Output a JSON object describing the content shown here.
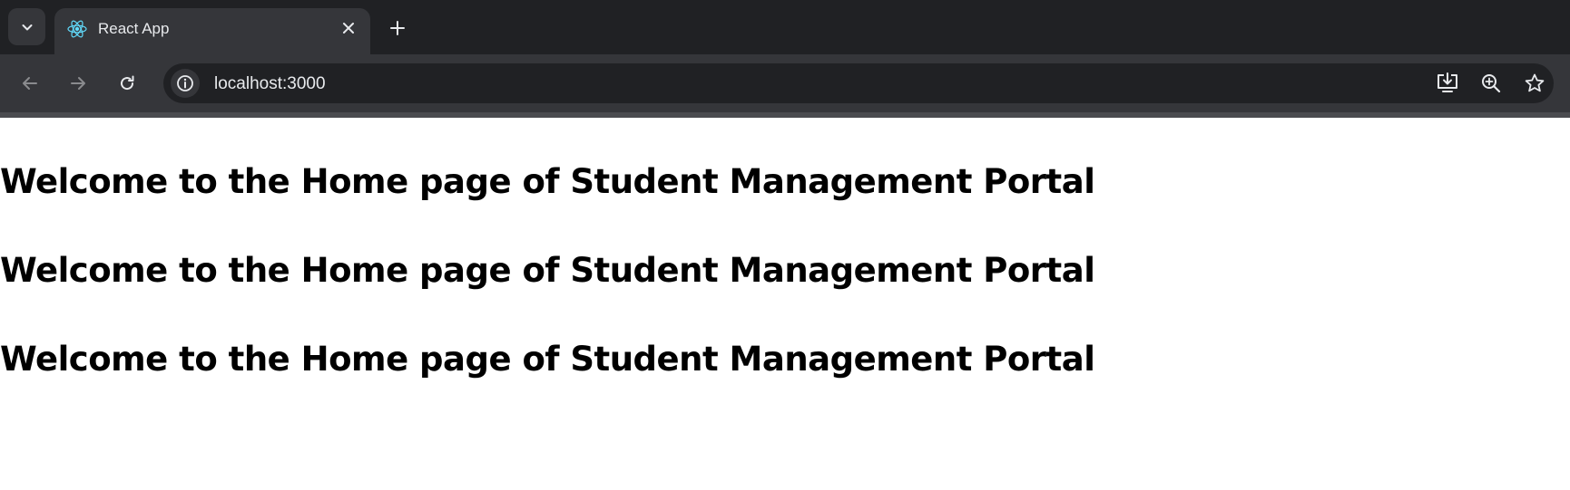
{
  "browser": {
    "tab": {
      "title": "React App",
      "favicon": "react-logo-icon"
    },
    "address_bar": {
      "url": "localhost:3000"
    },
    "colors": {
      "tabbar_bg": "#202124",
      "toolbar_bg": "#35363a",
      "omnibox_bg": "#202124",
      "text": "#e8eaed",
      "react_accent": "#61dafb"
    }
  },
  "page": {
    "headings": [
      "Welcome to the Home page of Student Management Portal",
      "Welcome to the Home page of Student Management Portal",
      "Welcome to the Home page of Student Management Portal"
    ]
  }
}
